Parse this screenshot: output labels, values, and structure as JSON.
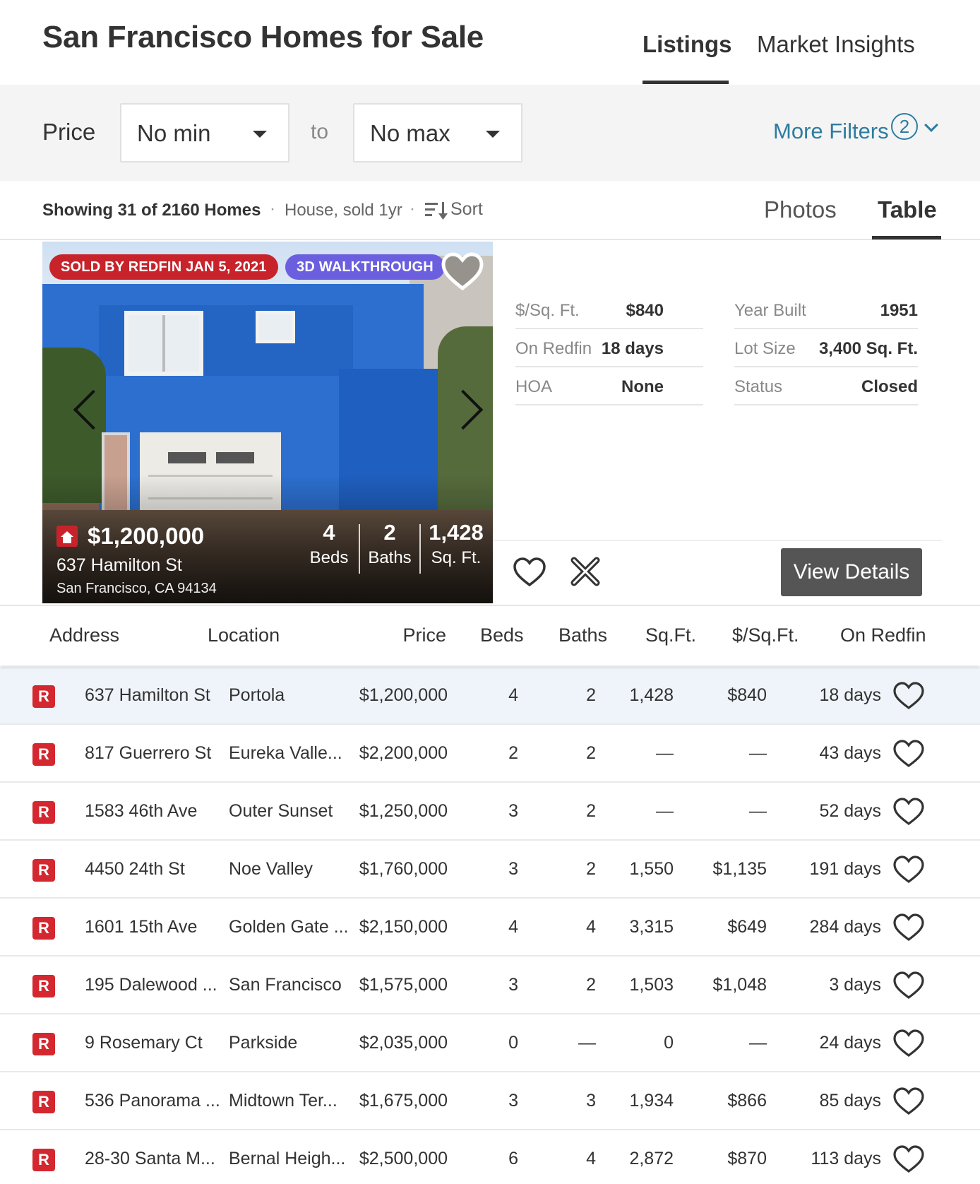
{
  "header": {
    "title": "San Francisco Homes for Sale",
    "tabs": [
      {
        "label": "Listings",
        "active": true
      },
      {
        "label": "Market Insights",
        "active": false
      }
    ]
  },
  "filters": {
    "price_label": "Price",
    "min_value": "No min",
    "to_label": "to",
    "max_value": "No max",
    "more_filters_label": "More Filters",
    "more_filters_count": "2",
    "accent_color": "#2e7ca0"
  },
  "results": {
    "showing": "Showing 31 of 2160 Homes",
    "separator": "·",
    "filter_summary": "House, sold 1yr",
    "sort_label": "Sort",
    "view_tabs": [
      {
        "label": "Photos",
        "active": false
      },
      {
        "label": "Table",
        "active": true
      }
    ]
  },
  "card": {
    "badge_sold": "SOLD BY REDFIN JAN 5, 2021",
    "badge_3d": "3D WALKTHROUGH",
    "badge_sold_color": "#c8232b",
    "badge_3d_color": "#6b5fe0",
    "price": "$1,200,000",
    "street": "637 Hamilton St",
    "city": "San Francisco, CA 94134",
    "beds_value": "4",
    "beds_label": "Beds",
    "baths_value": "2",
    "baths_label": "Baths",
    "sqft_value": "1,428",
    "sqft_label": "Sq. Ft.",
    "details": [
      {
        "label": "$/Sq. Ft.",
        "value": "$840",
        "label2": "Year Built",
        "value2": "1951"
      },
      {
        "label": "On Redfin",
        "value": "18 days",
        "label2": "Lot Size",
        "value2": "3,400 Sq. Ft."
      },
      {
        "label": "HOA",
        "value": "None",
        "label2": "Status",
        "value2": "Closed"
      }
    ],
    "view_details_label": "View Details",
    "icons": [
      "heart-icon",
      "x-icon",
      "chevron-left-icon",
      "chevron-right-icon",
      "redfin-home-icon"
    ]
  },
  "table": {
    "columns": [
      "Address",
      "Location",
      "Price",
      "Beds",
      "Baths",
      "Sq.Ft.",
      "$/Sq.Ft.",
      "On Redfin"
    ],
    "badge_letter": "R",
    "rows": [
      {
        "address": "637 Hamilton St",
        "location": "Portola",
        "price": "$1,200,000",
        "beds": "4",
        "baths": "2",
        "sqft": "1,428",
        "ppsf": "$840",
        "days": "18 days"
      },
      {
        "address": "817 Guerrero St",
        "location": "Eureka Valle...",
        "price": "$2,200,000",
        "beds": "2",
        "baths": "2",
        "sqft": "—",
        "ppsf": "—",
        "days": "43 days"
      },
      {
        "address": "1583 46th Ave",
        "location": "Outer Sunset",
        "price": "$1,250,000",
        "beds": "3",
        "baths": "2",
        "sqft": "—",
        "ppsf": "—",
        "days": "52 days"
      },
      {
        "address": "4450 24th St",
        "location": "Noe Valley",
        "price": "$1,760,000",
        "beds": "3",
        "baths": "2",
        "sqft": "1,550",
        "ppsf": "$1,135",
        "days": "191 days"
      },
      {
        "address": "1601 15th Ave",
        "location": "Golden Gate ...",
        "price": "$2,150,000",
        "beds": "4",
        "baths": "4",
        "sqft": "3,315",
        "ppsf": "$649",
        "days": "284 days"
      },
      {
        "address": "195 Dalewood ...",
        "location": "San Francisco",
        "price": "$1,575,000",
        "beds": "3",
        "baths": "2",
        "sqft": "1,503",
        "ppsf": "$1,048",
        "days": "3 days"
      },
      {
        "address": "9 Rosemary Ct",
        "location": "Parkside",
        "price": "$2,035,000",
        "beds": "0",
        "baths": "—",
        "sqft": "0",
        "ppsf": "—",
        "days": "24 days"
      },
      {
        "address": "536 Panorama ...",
        "location": "Midtown Ter...",
        "price": "$1,675,000",
        "beds": "3",
        "baths": "3",
        "sqft": "1,934",
        "ppsf": "$866",
        "days": "85 days"
      },
      {
        "address": "28-30 Santa M...",
        "location": "Bernal Heigh...",
        "price": "$2,500,000",
        "beds": "6",
        "baths": "4",
        "sqft": "2,872",
        "ppsf": "$870",
        "days": "113 days"
      }
    ]
  }
}
